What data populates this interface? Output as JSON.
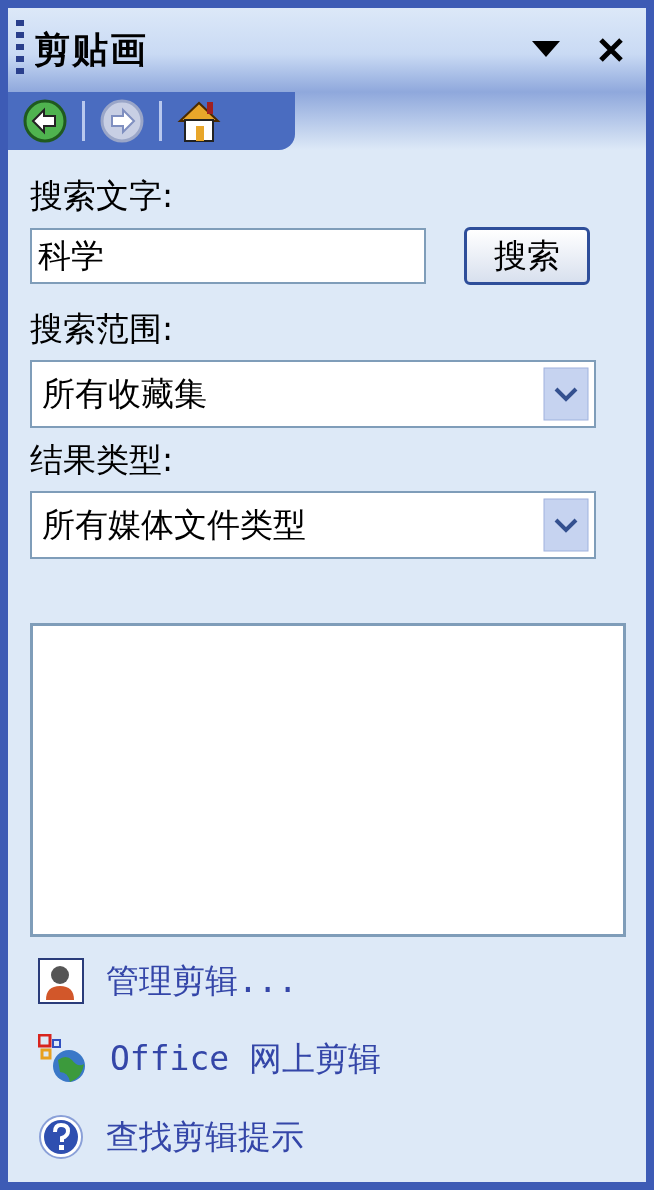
{
  "pane": {
    "title": "剪贴画"
  },
  "nav": [
    {
      "kind": "back",
      "disabled": false
    },
    {
      "kind": "forward",
      "disabled": true
    },
    {
      "kind": "home",
      "disabled": false
    }
  ],
  "search": {
    "label": "搜索文字:",
    "value": "科学",
    "button": "搜索"
  },
  "scope": {
    "label": "搜索范围:",
    "value": "所有收藏集"
  },
  "types": {
    "label": "结果类型:",
    "value": "所有媒体文件类型"
  },
  "links": [
    {
      "kind": "organize",
      "text": "管理剪辑..."
    },
    {
      "kind": "online",
      "text": "Office 网上剪辑"
    },
    {
      "kind": "help",
      "text": "查找剪辑提示"
    }
  ]
}
